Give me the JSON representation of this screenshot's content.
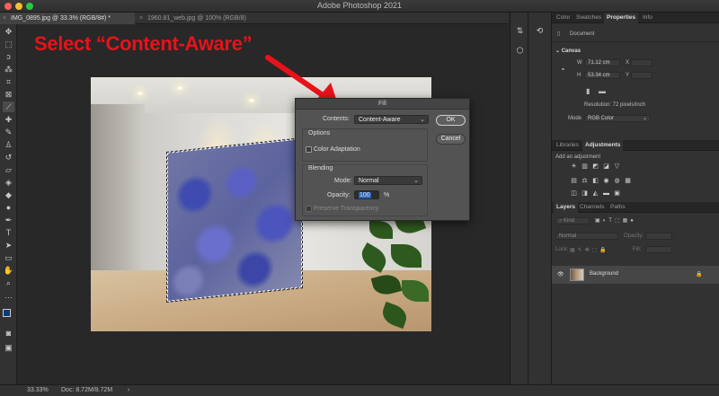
{
  "window": {
    "title": "Adobe Photoshop 2021",
    "traffic_lights": [
      "#fe5f57",
      "#febc2e",
      "#28c840"
    ]
  },
  "doc_tabs": [
    {
      "label": "IMG_0895.jpg @ 33.3% (RGB/8#) *",
      "active": true
    },
    {
      "label": "1960.81_web.jpg @ 100% (RGB/8)",
      "active": false
    }
  ],
  "annotation": {
    "text": "Select “Content-Aware”",
    "color": "#e8121b"
  },
  "fill_dialog": {
    "title": "Fill",
    "contents_label": "Contents:",
    "contents_value": "Content-Aware",
    "options_label": "Options",
    "color_adaptation_label": "Color Adaptation",
    "blending_label": "Blending",
    "mode_label": "Mode:",
    "mode_value": "Normal",
    "opacity_label": "Opacity:",
    "opacity_value": "100",
    "opacity_unit": "%",
    "preserve_transparency_label": "Preserve Transparency",
    "ok_label": "OK",
    "cancel_label": "Cancel"
  },
  "properties_panel": {
    "tabs": [
      "Color",
      "Swatches",
      "Properties",
      "Info"
    ],
    "active_tab": "Properties",
    "doc_label": "Document",
    "canvas_label": "Canvas",
    "w_label": "W",
    "w_value": "71.12 cm",
    "h_label": "H",
    "h_value": "53.34 cm",
    "x_label": "X",
    "y_label": "Y",
    "resolution": "Resolution: 72 pixels/inch",
    "mode_label": "Mode",
    "mode_value": "RGB Color"
  },
  "adjustments_panel": {
    "tabs": [
      "Libraries",
      "Adjustments"
    ],
    "active_tab": "Adjustments",
    "hint": "Add an adjustment"
  },
  "layers_panel": {
    "tabs": [
      "Layers",
      "Channels",
      "Paths"
    ],
    "active_tab": "Layers",
    "blend_mode": "Normal",
    "opacity_label": "Opacity:",
    "lock_label": "Lock:",
    "fill_label": "Fill:",
    "layer_name": "Background"
  },
  "status": {
    "zoom": "33.33%",
    "doc": "Doc: 8.72M/8.72M"
  }
}
